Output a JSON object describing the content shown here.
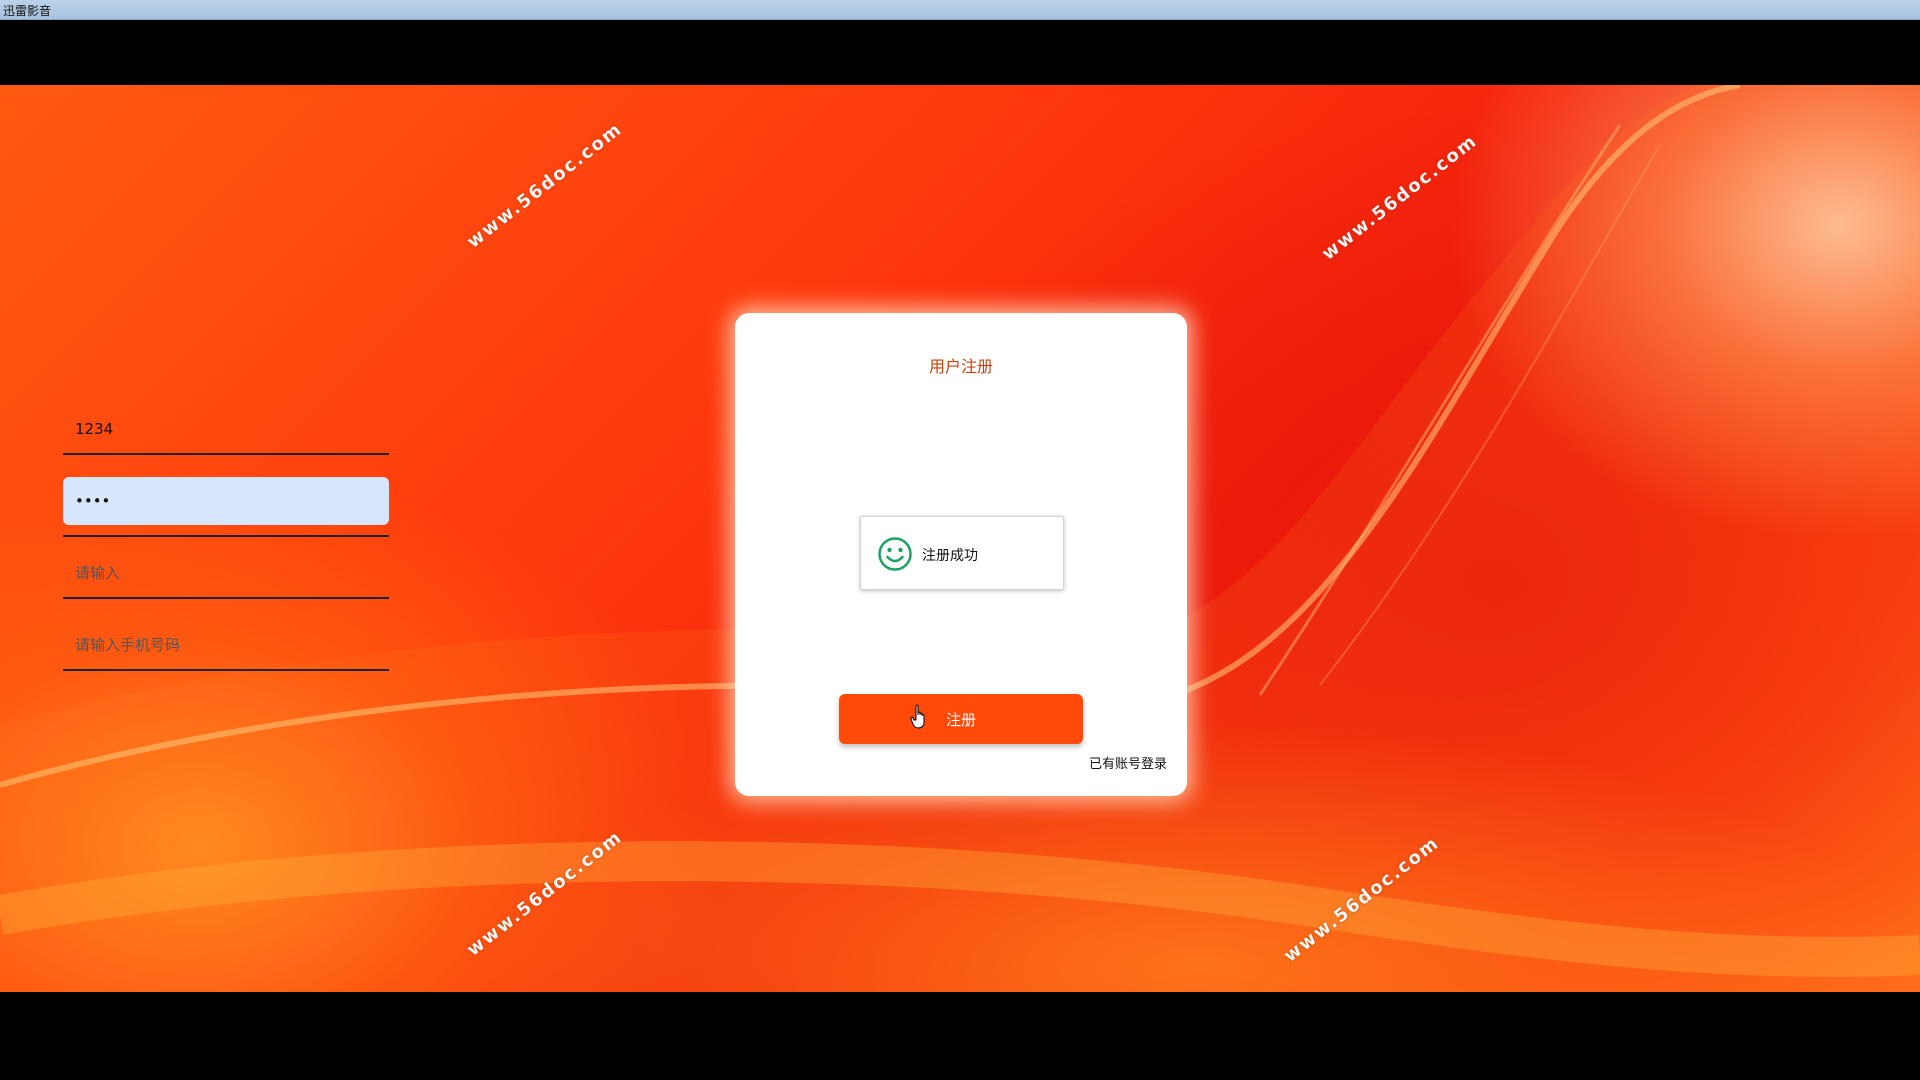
{
  "window": {
    "title": "迅雷影音"
  },
  "watermarks": [
    "www.56doc.com",
    "www.56doc.com",
    "www.56doc.com",
    "www.56doc.com",
    "www.56doc.com",
    "www.56doc.com"
  ],
  "form": {
    "title": "用户注册",
    "username_value": "1234",
    "password_value": "1234",
    "confirm_placeholder": "请输入",
    "phone_placeholder": "请输入手机号码",
    "register_label": "注册",
    "login_link": "已有账号登录"
  },
  "toast": {
    "message": "注册成功",
    "icon": "smiley-icon",
    "icon_color": "#1aa260"
  },
  "colors": {
    "accent": "#ff4a0a",
    "title_color": "#c8420e",
    "focused_field_bg": "#d7e6fb"
  }
}
